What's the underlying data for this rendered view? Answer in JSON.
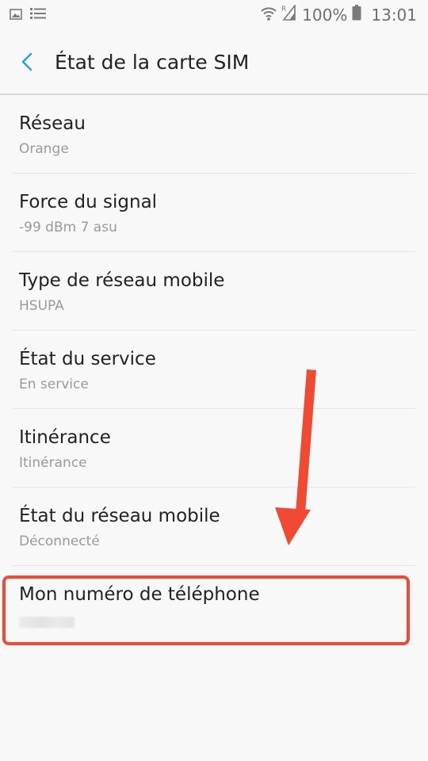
{
  "status_bar": {
    "icons": [
      "image-icon",
      "list-icon",
      "wifi-icon",
      "roaming-signal-icon",
      "battery-icon"
    ],
    "battery_percent": "100%",
    "time": "13:01"
  },
  "header": {
    "title": "État de la carte SIM",
    "back_icon": "back-arrow-icon",
    "accent_color": "#2aa1d3"
  },
  "items": [
    {
      "title": "Réseau",
      "value": "Orange"
    },
    {
      "title": "Force du signal",
      "value": "-99 dBm 7 asu"
    },
    {
      "title": "Type de réseau mobile",
      "value": "HSUPA"
    },
    {
      "title": "État du service",
      "value": "En service"
    },
    {
      "title": "Itinérance",
      "value": "Itinérance"
    },
    {
      "title": "État du réseau mobile",
      "value": "Déconnecté"
    },
    {
      "title": "Mon numéro de téléphone",
      "value": ""
    }
  ],
  "annotation": {
    "color": "#f04a33",
    "arrow_icon": "down-arrow-annotation"
  }
}
